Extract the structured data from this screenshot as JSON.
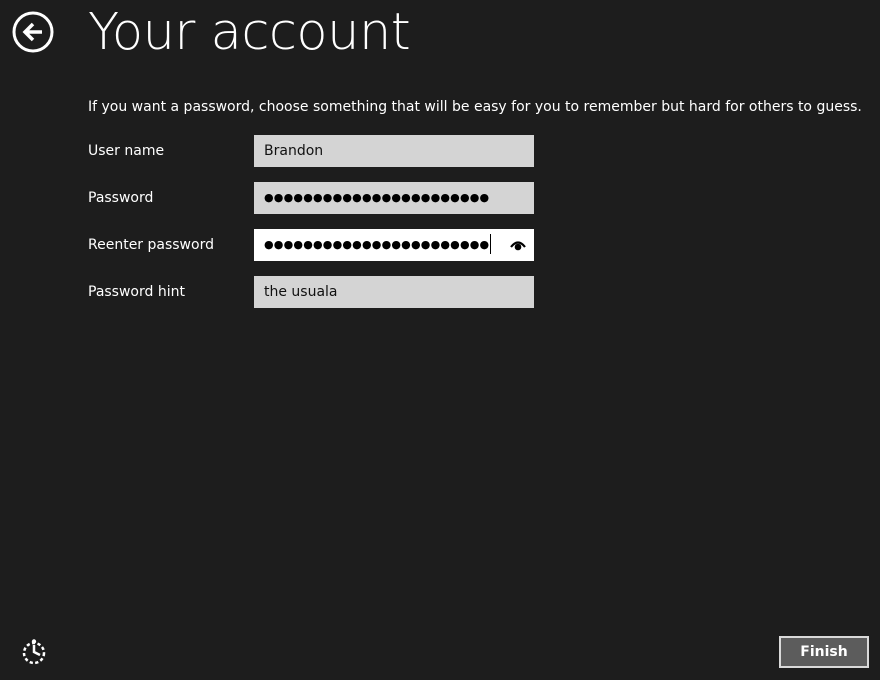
{
  "header": {
    "back_icon": "back-arrow-circle-icon",
    "title": "Your account"
  },
  "instructions": "If you want a password, choose something that will be easy for you to remember but hard for others to guess.",
  "form": {
    "username": {
      "label": "User name",
      "value": "Brandon"
    },
    "password": {
      "label": "Password",
      "masked_value": "●●●●●●●●●●●●●●●●●●●●●●●"
    },
    "reenter_password": {
      "label": "Reenter password",
      "masked_value": "●●●●●●●●●●●●●●●●●●●●●●●",
      "reveal_icon": "eye-icon",
      "focused": true
    },
    "password_hint": {
      "label": "Password hint",
      "value": "the usuala"
    }
  },
  "footer": {
    "ease_of_access_icon": "ease-of-access-icon",
    "finish_label": "Finish"
  },
  "colors": {
    "background": "#1d1d1d",
    "field_background": "#d4d4d4",
    "field_focused": "#ffffff",
    "button_background": "#5c5c5c",
    "text": "#ffffff"
  }
}
